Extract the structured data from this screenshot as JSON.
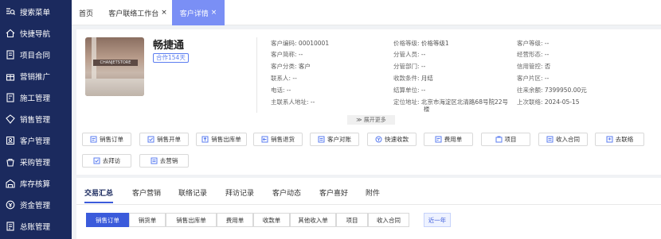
{
  "sidebar": {
    "items": [
      {
        "label": "搜索菜单",
        "icon": "search-menu-icon"
      },
      {
        "label": "快捷导航",
        "icon": "home-icon"
      },
      {
        "label": "项目合同",
        "icon": "contract-icon"
      },
      {
        "label": "营销推广",
        "icon": "gift-icon"
      },
      {
        "label": "施工管理",
        "icon": "construction-icon"
      },
      {
        "label": "销售管理",
        "icon": "sales-icon"
      },
      {
        "label": "客户管理",
        "icon": "customer-icon"
      },
      {
        "label": "采购管理",
        "icon": "purchase-icon"
      },
      {
        "label": "库存核算",
        "icon": "inventory-icon"
      },
      {
        "label": "资金管理",
        "icon": "fund-icon"
      },
      {
        "label": "总账管理",
        "icon": "ledger-icon"
      }
    ]
  },
  "tabs": [
    {
      "label": "首页"
    },
    {
      "label": "客户联络工作台",
      "close": "×"
    },
    {
      "label": "客户详情",
      "close": "×"
    }
  ],
  "customer": {
    "name": "畅捷通",
    "badge": "合作154天",
    "photo_sign": "CHANJETSTORE"
  },
  "info": {
    "col1": [
      {
        "label": "客户编码:",
        "value": "00010001"
      },
      {
        "label": "客户简称:",
        "value": "--"
      },
      {
        "label": "客户分类:",
        "value": "客户"
      },
      {
        "label": "联系人:",
        "value": "--"
      },
      {
        "label": "电话:",
        "value": "--"
      },
      {
        "label": "主联系人地址:",
        "value": "--"
      }
    ],
    "col2": [
      {
        "label": "价格等级:",
        "value": "价格等级1"
      },
      {
        "label": "分管人员:",
        "value": "--"
      },
      {
        "label": "分管部门:",
        "value": "--"
      },
      {
        "label": "收款条件:",
        "value": "月结"
      },
      {
        "label": "结算单位:",
        "value": "--"
      },
      {
        "label": "定位地址:",
        "value": "北京市海淀区北清路68号院22号",
        "value2": "楼"
      }
    ],
    "col3": [
      {
        "label": "客户等级:",
        "value": "--"
      },
      {
        "label": "经营形态:",
        "value": "--"
      },
      {
        "label": "信用管控:",
        "value": "否"
      },
      {
        "label": "客户片区:",
        "value": "--"
      },
      {
        "label": "往来余额:",
        "value": "7399950.00元"
      },
      {
        "label": "上次联络:",
        "value": "2024-05-15"
      }
    ]
  },
  "expand_more": "展开更多",
  "actions_row1": [
    {
      "label": "销售订单",
      "icon": "order-icon"
    },
    {
      "label": "销售开单",
      "icon": "invoice-icon"
    },
    {
      "label": "销售出库单",
      "icon": "outbound-icon"
    },
    {
      "label": "销售退货",
      "icon": "return-icon"
    },
    {
      "label": "客户对账",
      "icon": "reconcile-icon"
    },
    {
      "label": "快速收款",
      "icon": "payment-icon"
    },
    {
      "label": "费用单",
      "icon": "expense-icon"
    },
    {
      "label": "项目",
      "icon": "project-icon"
    },
    {
      "label": "收入合同",
      "icon": "income-contract-icon"
    },
    {
      "label": "去联络",
      "icon": "contact-icon"
    }
  ],
  "actions_row2": [
    {
      "label": "去拜访",
      "icon": "visit-icon"
    },
    {
      "label": "去营销",
      "icon": "marketing-icon"
    }
  ],
  "bottom_tabs": [
    "交易汇总",
    "客户营销",
    "联络记录",
    "拜访记录",
    "客户动态",
    "客户喜好",
    "附件"
  ],
  "sub_tabs": [
    "销售订单",
    "销货单",
    "销售出库单",
    "费用单",
    "收款单",
    "其他收入单",
    "项目",
    "收入合同"
  ],
  "period_link": "近一年",
  "colors": {
    "sidebar": "#1b2a5e",
    "accent": "#3b5bdb",
    "active_tab": "#7a8ff5"
  }
}
